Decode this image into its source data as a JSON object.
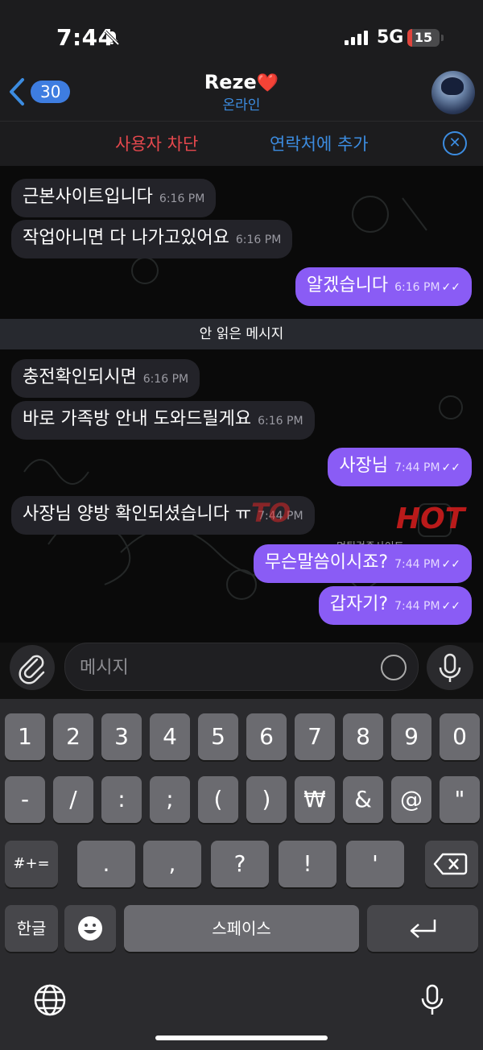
{
  "status": {
    "time": "7:44",
    "network": "5G",
    "battery": "15",
    "battery_level": 0.15
  },
  "header": {
    "back_count": "30",
    "name": "Reze",
    "heart": "❤️",
    "status": "온라인"
  },
  "actions": {
    "block": "사용자 차단",
    "add_contact": "연락처에 추가"
  },
  "messages": [
    {
      "dir": "in",
      "text": "근본사이트입니다",
      "time": "6:16 PM"
    },
    {
      "dir": "in",
      "text": "작업아니면 다 나가고있어요",
      "time": "6:16 PM"
    },
    {
      "dir": "out",
      "text": "알겠습니다",
      "time": "6:16 PM"
    },
    {
      "dir": "in",
      "text": "충전확인되시면",
      "time": "6:16 PM"
    },
    {
      "dir": "in",
      "text": "바로 가족방 안내 도와드릴게요",
      "time": "6:16 PM"
    },
    {
      "dir": "out",
      "text": "사장님",
      "time": "7:44 PM"
    },
    {
      "dir": "in",
      "text": "사장님 양방 확인되셨습니다 ㅠ",
      "time": "7:44 PM"
    },
    {
      "dir": "out",
      "text": "무슨말씀이시죠?",
      "time": "7:44 PM"
    },
    {
      "dir": "out",
      "text": "갑자기?",
      "time": "7:44 PM"
    }
  ],
  "unread_divider": "안 읽은 메시지",
  "watermark": {
    "brand_left": "TO",
    "brand_right": "HOT",
    "tagline": "먹튀검증사이트"
  },
  "composer": {
    "placeholder": "메시지"
  },
  "keyboard": {
    "row1": [
      "1",
      "2",
      "3",
      "4",
      "5",
      "6",
      "7",
      "8",
      "9",
      "0"
    ],
    "row2": [
      "-",
      "/",
      ":",
      ";",
      "(",
      ")",
      "₩",
      "&",
      "@",
      "\""
    ],
    "row3_mode": "#+=",
    "row3": [
      ".",
      ",",
      "?",
      "!",
      "'"
    ],
    "lang": "한글",
    "space": "스페이스"
  },
  "colors": {
    "outgoing": "#8a5cf5",
    "incoming": "#232329",
    "accent": "#3c8ce0",
    "danger": "#e5484d"
  }
}
